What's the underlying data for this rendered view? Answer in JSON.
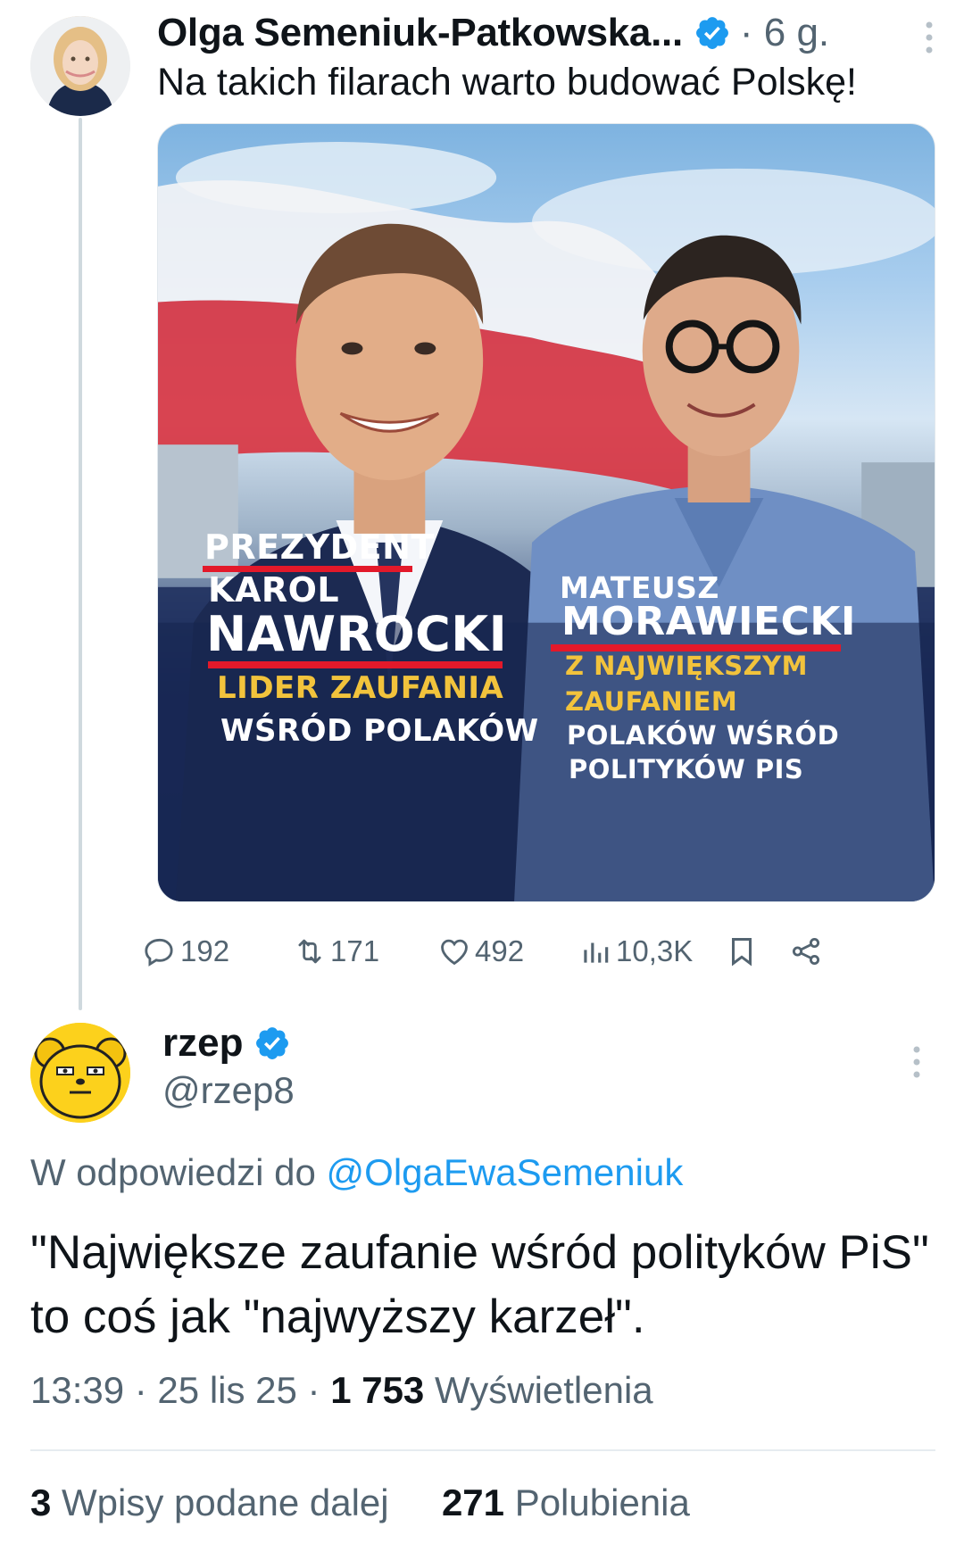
{
  "tweet": {
    "author_name": "Olga Semeniuk-Patkowska...",
    "time": "· 6 g.",
    "text": "Na takich filarach warto budować Polskę!",
    "media": {
      "left_lines": [
        "PREZYDENT",
        "KAROL",
        "NAWROCKI",
        "LIDER ZAUFANIA",
        "WŚRÓD POLAKÓW"
      ],
      "right_lines": [
        "MATEUSZ",
        "MORAWIECKI",
        "Z NAJWIĘKSZYM",
        "ZAUFANIEM",
        "POLAKÓW WŚRÓD",
        "POLITYKÓW PIS"
      ]
    },
    "actions": {
      "replies": "192",
      "reposts": "171",
      "likes": "492",
      "views": "10,3K"
    }
  },
  "reply": {
    "author_name": "rzep",
    "handle": "@rzep8",
    "reply_to_prefix": "W odpowiedzi do",
    "reply_to_mention": "@OlgaEwaSemeniuk",
    "text": "\"Największe zaufanie wśród polityków PiS\" to coś jak \"najwyższy karzeł\".",
    "time": "13:39 · 25 lis 25 ·",
    "views_count": "1 753",
    "views_label": "Wyświetlenia",
    "reposts_count": "3",
    "reposts_label": "Wpisy podane dalej",
    "likes_count": "271",
    "likes_label": "Polubienia"
  },
  "colors": {
    "accent": "#1d9bf0",
    "text": "#0f1419",
    "secondary": "#536471",
    "poster_navy": "#16254f",
    "poster_red": "#e3192a",
    "poster_yellow": "#f2c33c"
  },
  "icons": [
    "verified-badge-icon",
    "more-options-icon",
    "reply-icon",
    "repost-icon",
    "like-icon",
    "views-icon",
    "bookmark-icon",
    "share-icon"
  ]
}
